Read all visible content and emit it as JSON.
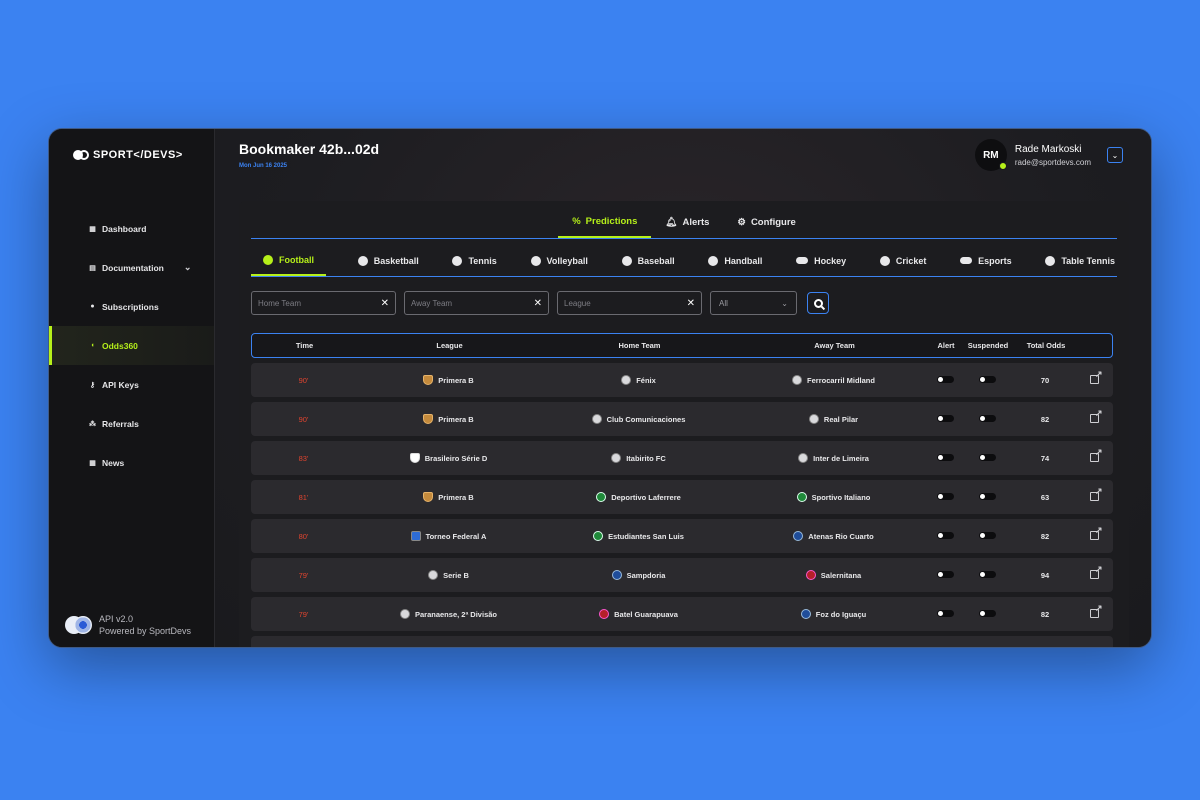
{
  "brand": {
    "logo_text": "SPORT</DEVS>",
    "api_version": "API v2.0",
    "powered_by": "Powered by SportDevs"
  },
  "sidebar": {
    "items": [
      {
        "label": "Dashboard",
        "icon": "grid-icon"
      },
      {
        "label": "Documentation",
        "icon": "book-icon"
      },
      {
        "label": "Subscriptions",
        "icon": "plus-circle-icon"
      },
      {
        "label": "Odds360",
        "icon": "odds-icon",
        "active": true
      },
      {
        "label": "API Keys",
        "icon": "key-icon"
      },
      {
        "label": "Referrals",
        "icon": "share-icon"
      },
      {
        "label": "News",
        "icon": "news-icon"
      }
    ]
  },
  "header": {
    "title": "Bookmaker 42b...02d",
    "date": "Mon Jun 16 2025"
  },
  "user": {
    "initials": "RM",
    "name": "Rade Markoski",
    "email": "rade@sportdevs.com"
  },
  "top_tabs": [
    {
      "label": "Predictions",
      "icon": "percent-icon",
      "active": true
    },
    {
      "label": "Alerts",
      "icon": "bell-icon"
    },
    {
      "label": "Configure",
      "icon": "gear-icon"
    }
  ],
  "sport_tabs": [
    {
      "label": "Football",
      "active": true
    },
    {
      "label": "Basketball"
    },
    {
      "label": "Tennis"
    },
    {
      "label": "Volleyball"
    },
    {
      "label": "Baseball"
    },
    {
      "label": "Handball"
    },
    {
      "label": "Hockey"
    },
    {
      "label": "Cricket"
    },
    {
      "label": "Esports"
    },
    {
      "label": "Table Tennis"
    }
  ],
  "filters": {
    "home_placeholder": "Home Team",
    "away_placeholder": "Away Team",
    "league_placeholder": "League",
    "status_value": "All"
  },
  "table": {
    "headers": [
      "Time",
      "League",
      "Home Team",
      "Away Team",
      "Alert",
      "Suspended",
      "Total Odds"
    ],
    "rows": [
      {
        "time": "90'",
        "league": "Primera B",
        "home": "Fénix",
        "away": "Ferrocarril Midland",
        "odds": "70"
      },
      {
        "time": "90'",
        "league": "Primera B",
        "home": "Club Comunicaciones",
        "away": "Real Pilar",
        "odds": "82"
      },
      {
        "time": "83'",
        "league": "Brasileiro Série D",
        "home": "Itabirito FC",
        "away": "Inter de Limeira",
        "odds": "74"
      },
      {
        "time": "81'",
        "league": "Primera B",
        "home": "Deportivo Laferrere",
        "away": "Sportivo Italiano",
        "odds": "63"
      },
      {
        "time": "80'",
        "league": "Torneo Federal A",
        "home": "Estudiantes San Luis",
        "away": "Atenas Rio Cuarto",
        "odds": "82"
      },
      {
        "time": "79'",
        "league": "Serie B",
        "home": "Sampdoria",
        "away": "Salernitana",
        "odds": "94"
      },
      {
        "time": "79'",
        "league": "Paranaense, 2ª Divisão",
        "home": "Batel Guarapuava",
        "away": "Foz do Iguaçu",
        "odds": "82"
      }
    ]
  },
  "colors": {
    "accent": "#b6f01a",
    "primary": "#3b82f1",
    "live_time": "#e0442f"
  }
}
